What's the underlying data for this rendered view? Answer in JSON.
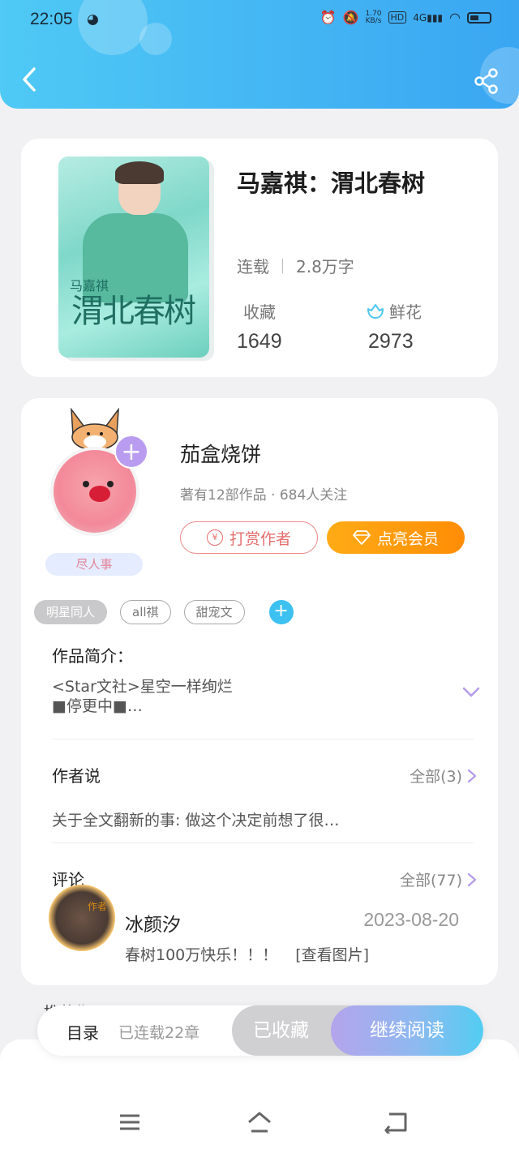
{
  "status_bar": {
    "time": "22:05",
    "net_speed_value": "1.70",
    "net_speed_unit": "KB/s",
    "hd": "HD",
    "network": "4G"
  },
  "colors": {
    "header_start": "#4fc9f5",
    "header_end": "#3aa6f2",
    "vip": "#ff9a0c",
    "tip": "#e56e6e",
    "accent_blue": "#3cc1f0",
    "accent_purple": "#b99cf0"
  },
  "icons": {
    "back": "chevron-left-icon",
    "share": "share-icon",
    "flower": "flower-icon",
    "expand": "chevron-down-icon",
    "more": "chevron-right-icon"
  },
  "book": {
    "title": "马嘉祺：渭北春树",
    "cover_text_small": "马嘉祺",
    "cover_text_large": "渭北春树",
    "status": "连载",
    "word_count": "2.8万字",
    "favorites_label": "收藏",
    "favorites_value": "1649",
    "flowers_label": "鲜花",
    "flowers_value": "2973"
  },
  "author": {
    "name": "茄盒烧饼",
    "info": "著有12部作品 · 684人关注",
    "avatar_tag": "尽人事",
    "follow_icon": "+",
    "tip_button": "打赏作者",
    "tip_icon": "¥",
    "vip_button": "点亮会员"
  },
  "tags": [
    "明星同人",
    "all祺",
    "甜宠文"
  ],
  "tag_add": "+",
  "intro": {
    "title": "作品简介：",
    "line1": "<Star文社>星空一样绚烂",
    "line2": "■停更中■…"
  },
  "author_says": {
    "title": "作者说",
    "more": "全部(3)",
    "text": "关于全文翻新的事: 做这个决定前想了很…"
  },
  "comments": {
    "title": "评论",
    "more": "全部(77)",
    "badge": "作者",
    "user": "冰颜汐",
    "date": "2023-08-20",
    "text": "春树100万快乐！！！",
    "link": "[查看图片]"
  },
  "peek": "推荐作品",
  "bottom_bar": {
    "toc": "目录",
    "chapters": "已连载22章",
    "collected": "已收藏",
    "continue": "继续阅读"
  },
  "nav": [
    "menu-icon",
    "home-icon",
    "back-icon"
  ]
}
